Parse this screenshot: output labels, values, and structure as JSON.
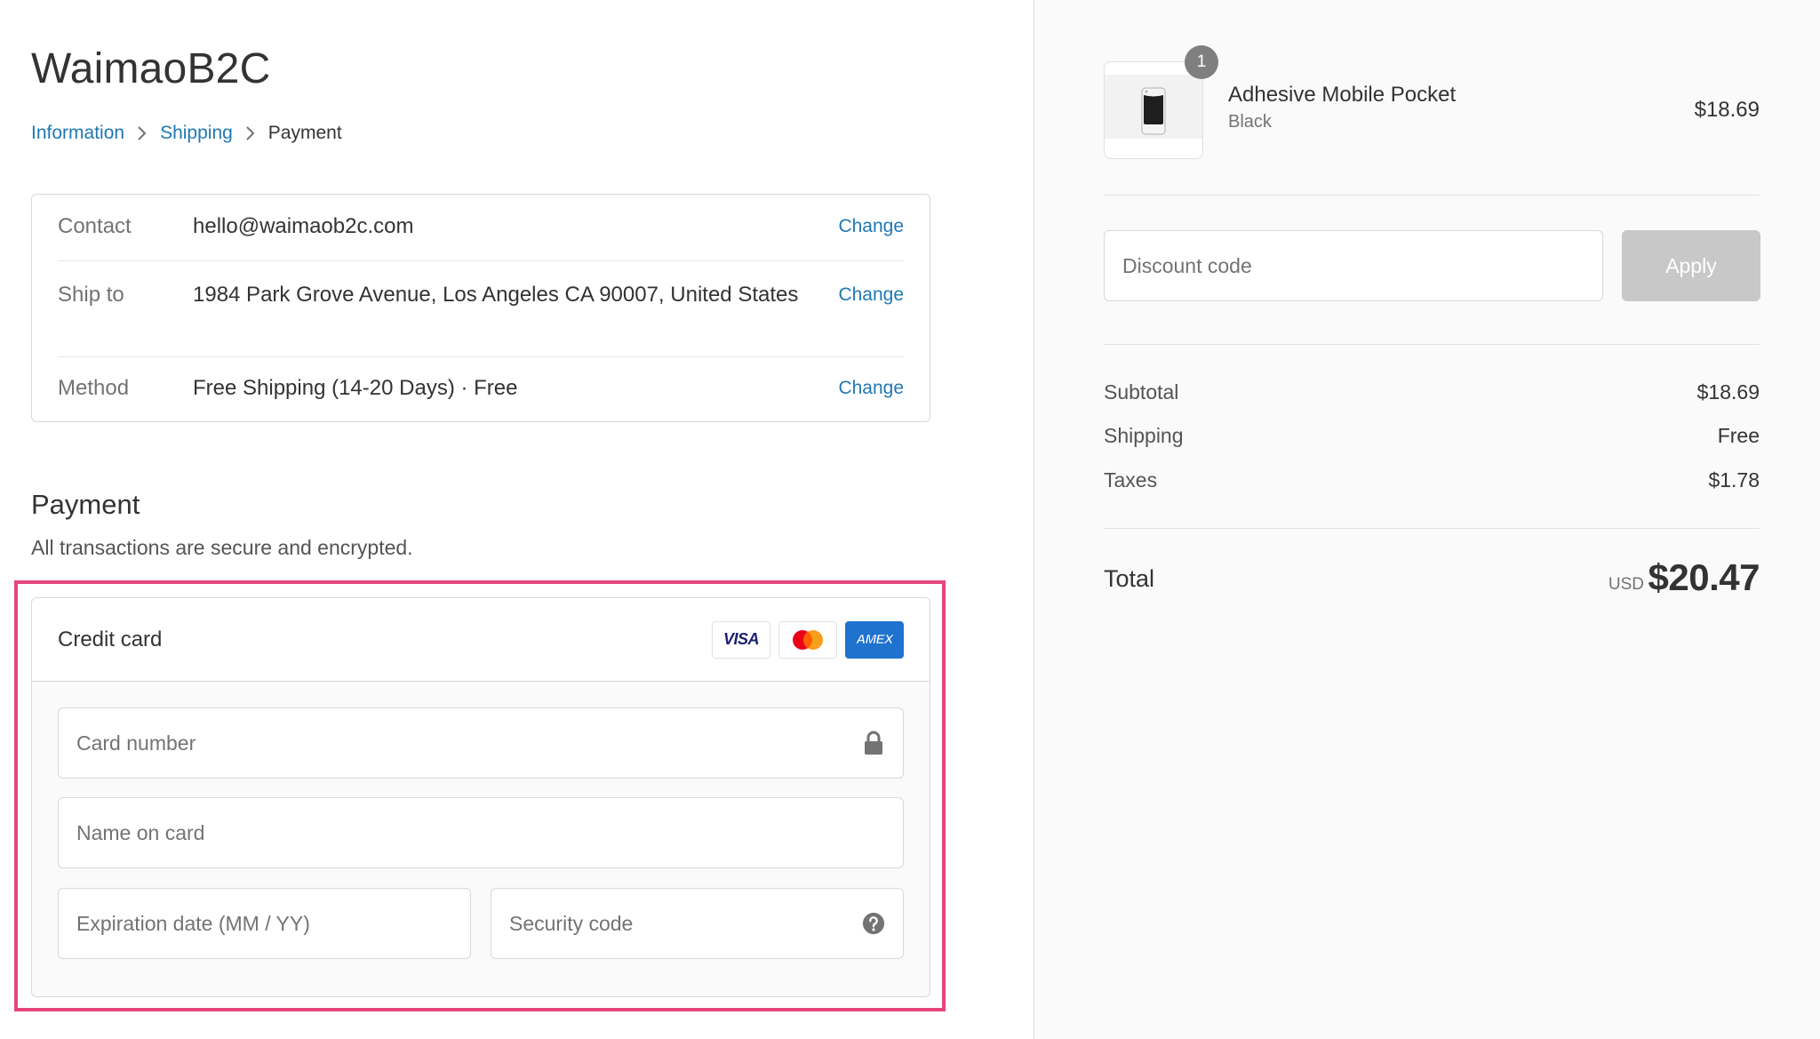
{
  "store": {
    "title": "WaimaoB2C"
  },
  "breadcrumb": [
    {
      "label": "Information",
      "link": true
    },
    {
      "label": "Shipping",
      "link": true
    },
    {
      "label": "Payment",
      "link": false
    }
  ],
  "review": {
    "change_label": "Change",
    "rows": [
      {
        "label": "Contact",
        "value": "hello@waimaob2c.com"
      },
      {
        "label": "Ship to",
        "value": "1984 Park Grove Avenue, Los Angeles CA 90007, United States"
      },
      {
        "label": "Method",
        "value": "Free Shipping (14-20 Days)",
        "value_suffix": " · ",
        "value_strong": "Free"
      }
    ]
  },
  "payment": {
    "title": "Payment",
    "subtitle": "All transactions are secure and encrypted.",
    "method_title": "Credit card",
    "card_brands": [
      {
        "name": "VISA",
        "icon": "visa-icon"
      },
      {
        "name": "Mastercard",
        "icon": "mastercard-icon"
      },
      {
        "name": "AMEX",
        "icon": "amex-icon"
      }
    ],
    "fields": {
      "card_number": {
        "placeholder": "Card number",
        "value": "",
        "icon": "lock-icon"
      },
      "name_on_card": {
        "placeholder": "Name on card",
        "value": ""
      },
      "expiration": {
        "placeholder": "Expiration date (MM / YY)",
        "value": ""
      },
      "security_code": {
        "placeholder": "Security code",
        "value": "",
        "icon": "help-icon"
      }
    },
    "highlight_color": "#e6457a"
  },
  "order": {
    "product": {
      "name": "Adhesive Mobile Pocket",
      "variant": "Black",
      "price": "$18.69",
      "quantity": "1"
    },
    "discount": {
      "placeholder": "Discount code",
      "value": "",
      "apply_label": "Apply"
    },
    "summary": [
      {
        "label": "Subtotal",
        "value": "$18.69"
      },
      {
        "label": "Shipping",
        "value": "Free"
      },
      {
        "label": "Taxes",
        "value": "$1.78"
      }
    ],
    "total": {
      "label": "Total",
      "currency": "USD",
      "amount": "$20.47"
    }
  },
  "colors": {
    "link": "#1f78b4",
    "highlight": "#e6457a",
    "amex": "#1f72cd",
    "apply_disabled": "#c8c8c8"
  }
}
